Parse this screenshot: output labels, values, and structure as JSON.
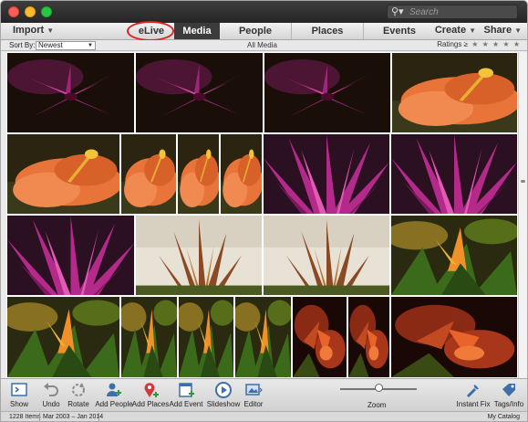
{
  "search": {
    "placeholder": "Search"
  },
  "menubar": {
    "import_label": "Import",
    "tabs": [
      {
        "label": "eLive",
        "active": false,
        "highlighted": true
      },
      {
        "label": "Media",
        "active": true
      },
      {
        "label": "People",
        "active": false
      },
      {
        "label": "Places",
        "active": false
      },
      {
        "label": "Events",
        "active": false
      }
    ],
    "create_label": "Create",
    "share_label": "Share"
  },
  "sortbar": {
    "sort_label": "Sort By:",
    "sort_value": "Newest",
    "view_label": "All Media",
    "ratings_label": "Ratings",
    "ratings_operator": "≥",
    "ratings_stars": 0
  },
  "photos": [
    {
      "subject": "purple-lily"
    },
    {
      "subject": "purple-lily"
    },
    {
      "subject": "purple-lily"
    },
    {
      "subject": "orange-hibiscus"
    },
    {
      "subject": "orange-hibiscus"
    },
    {
      "subject": "orange-hibiscus"
    },
    {
      "subject": "orange-hibiscus"
    },
    {
      "subject": "orange-hibiscus"
    },
    {
      "subject": "purple-bromeliad"
    },
    {
      "subject": "purple-bromeliad"
    },
    {
      "subject": "purple-bromeliad"
    },
    {
      "subject": "brown-bromeliad"
    },
    {
      "subject": "brown-bromeliad"
    },
    {
      "subject": "bird-of-paradise"
    },
    {
      "subject": "bird-of-paradise"
    },
    {
      "subject": "bird-of-paradise"
    },
    {
      "subject": "bird-of-paradise"
    },
    {
      "subject": "bird-of-paradise"
    },
    {
      "subject": "red-croton"
    },
    {
      "subject": "red-croton"
    },
    {
      "subject": "red-croton"
    }
  ],
  "toolbar": {
    "show_label": "Show",
    "undo_label": "Undo",
    "rotate_label": "Rotate",
    "add_people_label": "Add People",
    "add_places_label": "Add Places",
    "add_event_label": "Add Event",
    "slideshow_label": "Slideshow",
    "editor_label": "Editor",
    "zoom_label": "Zoom",
    "zoom_level": 0.5,
    "instant_fix_label": "Instant Fix",
    "tags_info_label": "Tags/Info"
  },
  "status": {
    "item_count": "1228 Items",
    "date_range": "Mar 2003 – Jan 2014",
    "catalog": "My Catalog"
  },
  "colors": {
    "tab_active_bg": "#3c3c3c",
    "elive_highlight": "#d6262a",
    "purple": "#8b1f6b",
    "orange": "#e8743a",
    "toolbar_blue": "#3d6fa8"
  }
}
